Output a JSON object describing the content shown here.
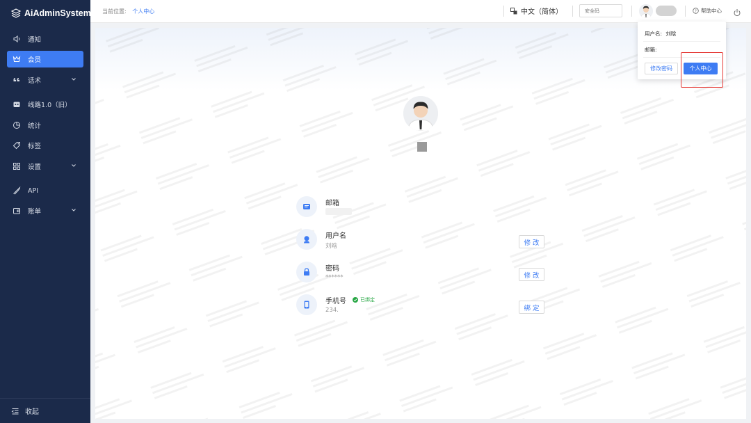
{
  "app": {
    "title": "AiAdminSystem"
  },
  "sidebar": {
    "items": [
      {
        "label": "通知",
        "icon": "speaker-icon",
        "active": false,
        "expandable": false
      },
      {
        "label": "会员",
        "icon": "crown-icon",
        "active": true,
        "expandable": false
      },
      {
        "label": "话术",
        "icon": "quote-icon",
        "active": false,
        "expandable": true
      },
      {
        "label": "线路1.0（旧）",
        "icon": "robot-icon",
        "active": false,
        "expandable": false
      },
      {
        "label": "统计",
        "icon": "pie-chart-icon",
        "active": false,
        "expandable": false
      },
      {
        "label": "标签",
        "icon": "tag-icon",
        "active": false,
        "expandable": false
      },
      {
        "label": "设置",
        "icon": "grid-icon",
        "active": false,
        "expandable": true
      },
      {
        "label": "API",
        "icon": "rocket-icon",
        "active": false,
        "expandable": false
      },
      {
        "label": "账单",
        "icon": "wallet-icon",
        "active": false,
        "expandable": true
      }
    ],
    "collapse_label": "收起"
  },
  "header": {
    "breadcrumb_prefix": "当前位置:",
    "breadcrumb_current": "个人中心",
    "language": "中文（简体）",
    "safe_code_placeholder": "安全码",
    "help_label": "帮助中心"
  },
  "profile": {
    "rows": [
      {
        "title": "邮箱",
        "value": "",
        "icon": "email-icon",
        "button": ""
      },
      {
        "title": "用户名",
        "value": "刘晗",
        "icon": "user-icon",
        "button": "修改"
      },
      {
        "title": "密码",
        "value": "******",
        "icon": "lock-icon",
        "button": "修改"
      },
      {
        "title": "手机号",
        "value": "234.",
        "icon": "phone-icon",
        "button": "绑定",
        "tag": "已绑定"
      }
    ]
  },
  "dropdown": {
    "username_label": "用户名:",
    "username_value": "刘晗",
    "email_label": "邮箱:",
    "change_password_button": "修改密码",
    "personal_center_button": "个人中心"
  },
  "colors": {
    "sidebar_bg": "#1b2a4a",
    "accent": "#3e7cf3",
    "highlight": "#e53935",
    "success": "#28a745"
  }
}
